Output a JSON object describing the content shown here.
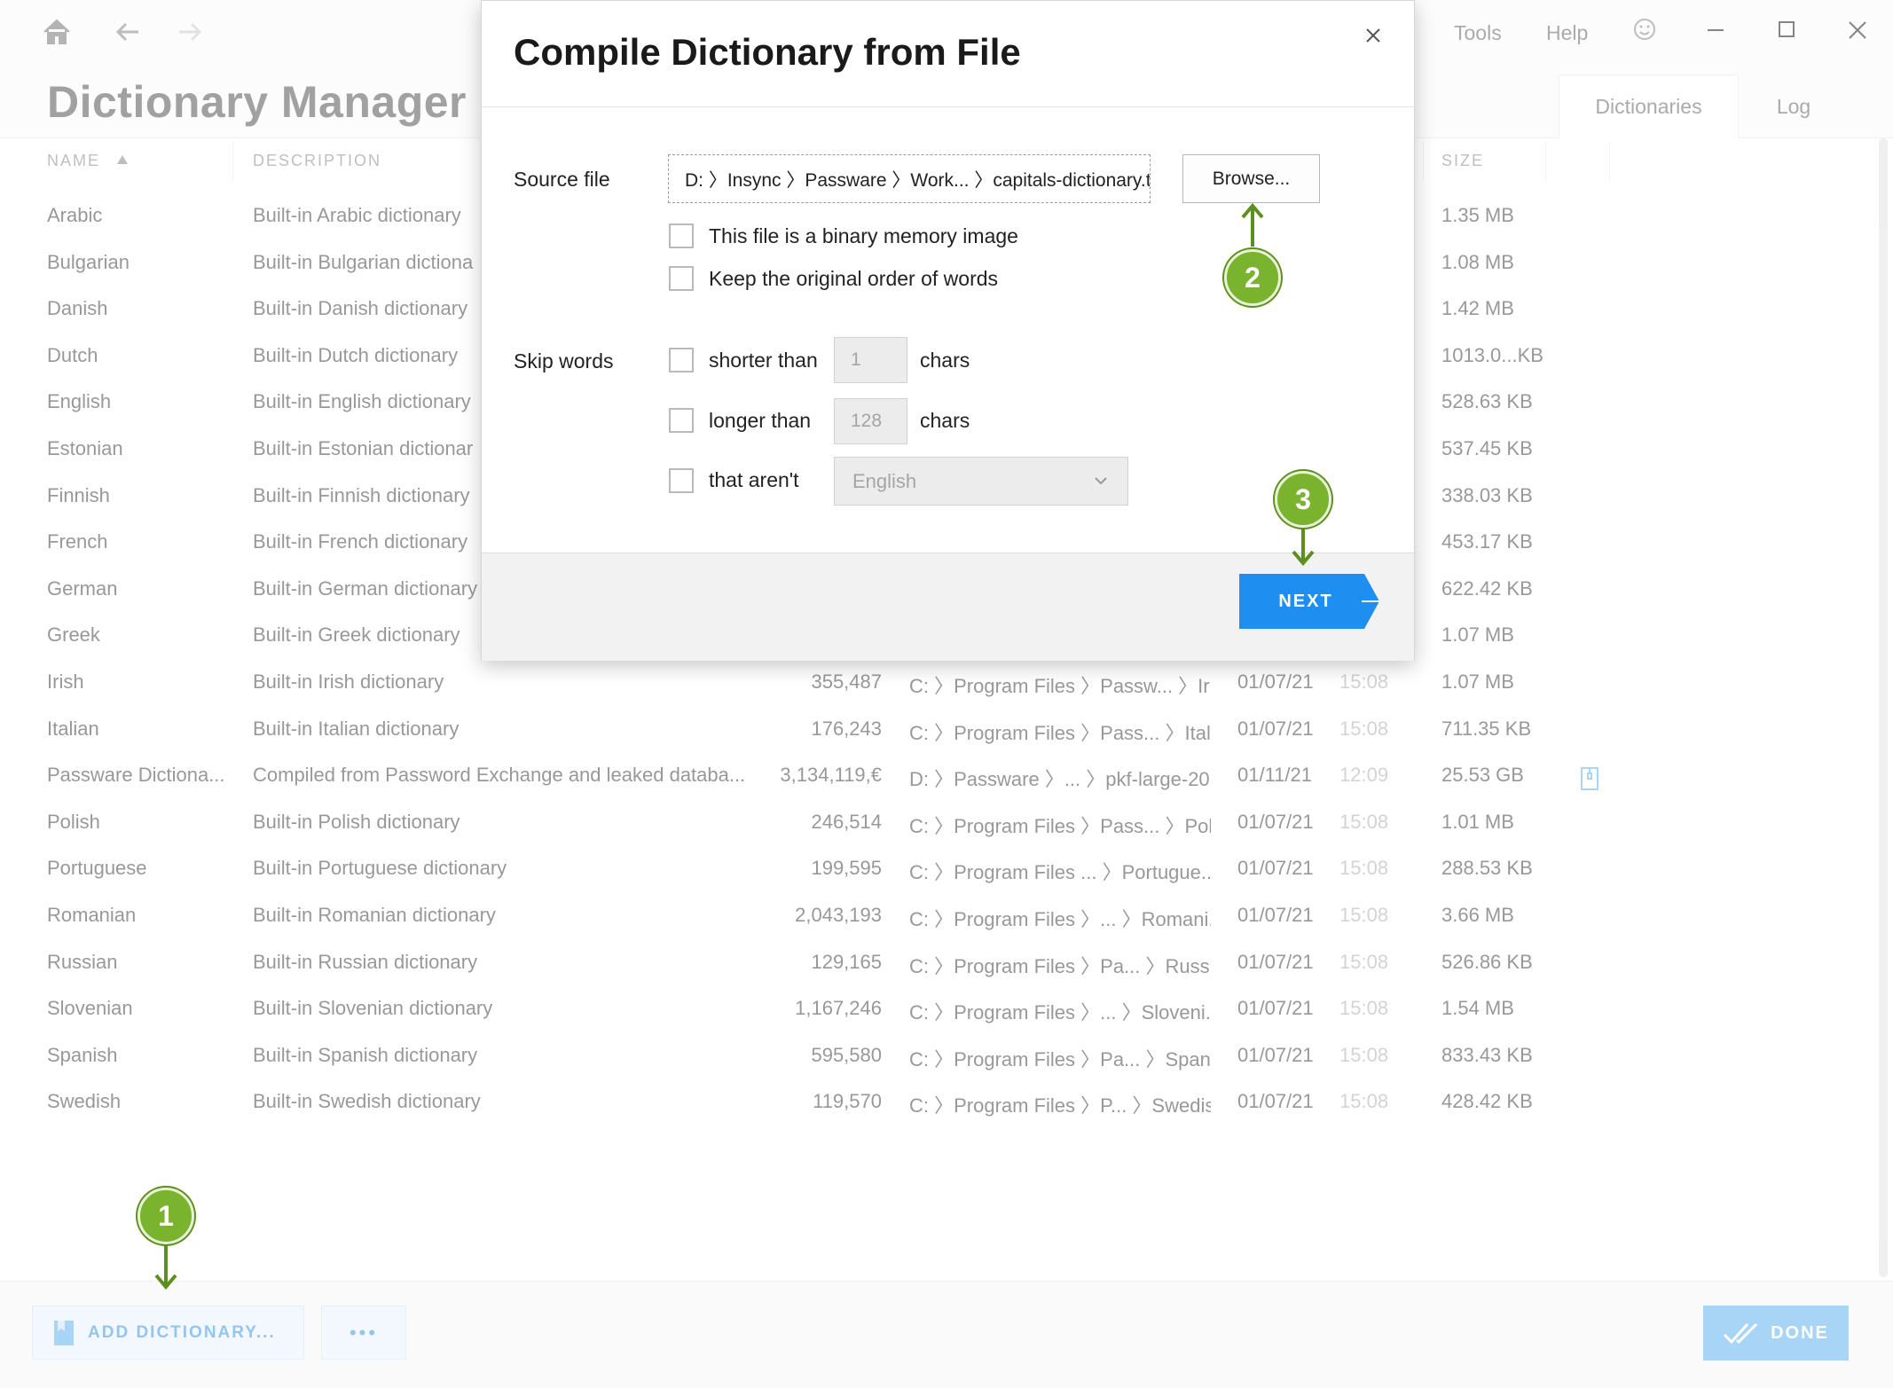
{
  "app": {
    "title": "Dictionary Manager",
    "menu": [
      "Tools",
      "Help"
    ],
    "view_tabs": [
      "Dictionaries",
      "Log"
    ],
    "columns": {
      "name": "NAME",
      "description": "DESCRIPTION",
      "size": "SIZE"
    },
    "rows": [
      {
        "name": "Arabic",
        "description": "Built-in Arabic dictionary",
        "words": "",
        "path": "",
        "date": "",
        "time": "",
        "size": "1.35 MB"
      },
      {
        "name": "Bulgarian",
        "description": "Built-in Bulgarian dictiona",
        "words": "",
        "path": "",
        "date": "",
        "time": "",
        "size": "1.08 MB"
      },
      {
        "name": "Danish",
        "description": "Built-in Danish dictionary",
        "words": "",
        "path": "",
        "date": "",
        "time": "",
        "size": "1.42 MB"
      },
      {
        "name": "Dutch",
        "description": "Built-in Dutch dictionary",
        "words": "",
        "path": "",
        "date": "",
        "time": "",
        "size": "1013.0...KB"
      },
      {
        "name": "English",
        "description": "Built-in English dictionary",
        "words": "",
        "path": "",
        "date": "",
        "time": "",
        "size": "528.63 KB"
      },
      {
        "name": "Estonian",
        "description": "Built-in Estonian dictionar",
        "words": "",
        "path": "",
        "date": "",
        "time": "",
        "size": "537.45 KB"
      },
      {
        "name": "Finnish",
        "description": "Built-in Finnish dictionary",
        "words": "",
        "path": "",
        "date": "",
        "time": "",
        "size": "338.03 KB"
      },
      {
        "name": "French",
        "description": "Built-in French dictionary",
        "words": "",
        "path": "",
        "date": "",
        "time": "",
        "size": "453.17 KB"
      },
      {
        "name": "German",
        "description": "Built-in German dictionary",
        "words": "",
        "path": "",
        "date": "",
        "time": "",
        "size": "622.42 KB"
      },
      {
        "name": "Greek",
        "description": "Built-in Greek dictionary",
        "words": "",
        "path": "",
        "date": "",
        "time": "",
        "size": "1.07 MB"
      },
      {
        "name": "Irish",
        "description": "Built-in Irish dictionary",
        "words": "355,487",
        "path": "C: 〉Program Files 〉Passw... 〉Irish",
        "date": "01/07/21",
        "time": "15:08",
        "size": "1.07 MB"
      },
      {
        "name": "Italian",
        "description": "Built-in Italian dictionary",
        "words": "176,243",
        "path": "C: 〉Program Files 〉Pass... 〉Italian",
        "date": "01/07/21",
        "time": "15:08",
        "size": "711.35 KB"
      },
      {
        "name": "Passware Dictiona...",
        "description": "Compiled from Password Exchange and leaked databa...",
        "words": "3,134,119,€",
        "path": "D: 〉Passware 〉... 〉pkf-large-20...",
        "date": "01/11/21",
        "time": "12:09",
        "size": "25.53 GB"
      },
      {
        "name": "Polish",
        "description": "Built-in Polish dictionary",
        "words": "246,514",
        "path": "C: 〉Program Files 〉Pass... 〉Polish",
        "date": "01/07/21",
        "time": "15:08",
        "size": "1.01 MB"
      },
      {
        "name": "Portuguese",
        "description": "Built-in Portuguese dictionary",
        "words": "199,595",
        "path": "C: 〉Program Files ... 〉Portugue...",
        "date": "01/07/21",
        "time": "15:08",
        "size": "288.53 KB"
      },
      {
        "name": "Romanian",
        "description": "Built-in Romanian dictionary",
        "words": "2,043,193",
        "path": "C: 〉Program Files 〉... 〉Romani...",
        "date": "01/07/21",
        "time": "15:08",
        "size": "3.66 MB"
      },
      {
        "name": "Russian",
        "description": "Built-in Russian dictionary",
        "words": "129,165",
        "path": "C: 〉Program Files 〉Pa... 〉Russian",
        "date": "01/07/21",
        "time": "15:08",
        "size": "526.86 KB"
      },
      {
        "name": "Slovenian",
        "description": "Built-in Slovenian dictionary",
        "words": "1,167,246",
        "path": "C: 〉Program Files 〉... 〉Sloveni...",
        "date": "01/07/21",
        "time": "15:08",
        "size": "1.54 MB"
      },
      {
        "name": "Spanish",
        "description": "Built-in Spanish dictionary",
        "words": "595,580",
        "path": "C: 〉Program Files 〉Pa... 〉Spanish",
        "date": "01/07/21",
        "time": "15:08",
        "size": "833.43 KB"
      },
      {
        "name": "Swedish",
        "description": "Built-in Swedish dictionary",
        "words": "119,570",
        "path": "C: 〉Program Files 〉P... 〉Swedish",
        "date": "01/07/21",
        "time": "15:08",
        "size": "428.42 KB"
      }
    ],
    "bottom": {
      "add_label": "ADD DICTIONARY...",
      "more_label": "•••",
      "done_label": "DONE"
    }
  },
  "dialog": {
    "title": "Compile Dictionary from File",
    "source_label": "Source file",
    "source_path": "D: 〉Insync 〉Passware 〉Work... 〉capitals-dictionary.t...",
    "browse_label": "Browse...",
    "binary_label": "This file is a binary memory image",
    "order_label": "Keep the original order of words",
    "skip_label": "Skip words",
    "shorter_label": "shorter than",
    "shorter_value": "1",
    "longer_label": "longer than",
    "longer_value": "128",
    "chars_label": "chars",
    "arent_label": "that aren't",
    "language_value": "English",
    "next_label": "NEXT"
  },
  "callouts": {
    "step1": "1",
    "step2": "2",
    "step3": "3"
  },
  "colors": {
    "accent": "#1e8ff0",
    "callout": "#7ab32e",
    "accent_light": "#62b2f0"
  },
  "icons": [
    "home-icon",
    "back-arrow-icon",
    "forward-arrow-icon",
    "smiley-icon",
    "minimize-icon",
    "maximize-icon",
    "close-icon",
    "sort-asc-icon",
    "book-icon",
    "check-done-icon",
    "chevron-down-icon",
    "archive-icon"
  ]
}
